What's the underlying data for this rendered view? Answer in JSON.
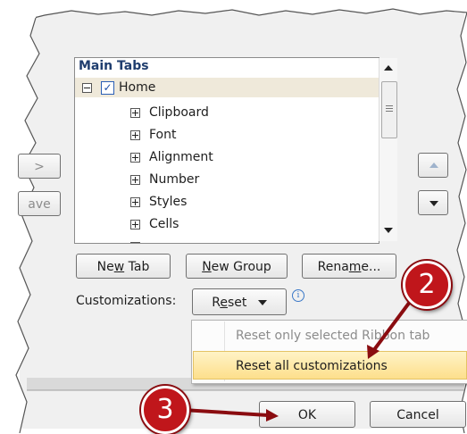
{
  "tree": {
    "header": "Main Tabs",
    "home": {
      "label": "Home",
      "checked": true
    },
    "children": [
      "Clipboard",
      "Font",
      "Alignment",
      "Number",
      "Styles",
      "Cells"
    ]
  },
  "side_buttons": {
    "add_partial": ">",
    "remove_partial": "ave"
  },
  "buttons": {
    "new_tab_pre": "Ne",
    "new_tab_u": "w",
    "new_tab_post": " Tab",
    "new_group_u": "N",
    "new_group_post": "ew Group",
    "rename_pre": "Rena",
    "rename_u": "m",
    "rename_post": "e...",
    "ok": "OK",
    "cancel": "Cancel"
  },
  "customizations": {
    "label": "Customizations:",
    "reset_pre": "R",
    "reset_u": "e",
    "reset_post": "set",
    "info_icon": "i"
  },
  "dropdown": {
    "items": [
      {
        "label": "Reset only selected Ribbon tab",
        "enabled": false
      },
      {
        "label": "Reset all customizations",
        "enabled": true,
        "highlighted": true
      }
    ]
  },
  "callouts": [
    "2",
    "3"
  ],
  "colors": {
    "callout": "#c0161b",
    "header": "#1f3d6e",
    "highlight": "#fddf8c"
  }
}
